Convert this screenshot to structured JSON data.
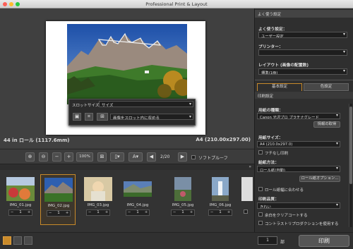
{
  "window": {
    "title": "Professional Print & Layout"
  },
  "slot": {
    "size_label": "スロットサイズ：",
    "size_value": "サイズ",
    "fit_value": "画像をスロット内に収める"
  },
  "info": {
    "roll": "44 in ロール (1117.6mm)",
    "paper": "A4 (210.00x297.00)"
  },
  "toolbar": {
    "zoom": "100%",
    "page": "2/20",
    "softproof": "ソフトプルーフ"
  },
  "thumbs": [
    {
      "name": "IMG_01.jpg",
      "count": "1"
    },
    {
      "name": "IMG_02.jpg",
      "count": "1"
    },
    {
      "name": "IMG_03.jpg",
      "count": "1"
    },
    {
      "name": "IMG_04.jpg",
      "count": "1"
    },
    {
      "name": "IMG_05.jpg",
      "count": "1"
    },
    {
      "name": "IMG_06.jpg",
      "count": "1"
    }
  ],
  "bottom": {
    "copies": "1",
    "unit": "部",
    "print": "印刷"
  },
  "right": {
    "favorites_header": "よく使う設定",
    "favorites_label": "よく使う設定：",
    "favorites_value": "ユーザー設定",
    "printer_label": "プリンター：",
    "layout_label": "レイアウト (画像の配置数)",
    "layout_value": "標準(1面)",
    "tab_basic": "基本設定",
    "tab_color": "色設定",
    "print_settings": "印刷設定",
    "media_label": "用紙の種類：",
    "media_value": "Canon 光沢プロ プラチナグレード",
    "get_info": "情報の取得",
    "paper_size_label": "用紙サイズ：",
    "paper_size_value": "A4 (210.0x297.0)",
    "borderless": "フチなし印刷",
    "feed_label": "給紙方法：",
    "feed_value": "ロール紙(自動)",
    "roll_options": "ロール紙オプション...",
    "fit_roll": "ロール紙幅に合わせる",
    "quality_label": "印刷品質：",
    "quality_value": "きれい",
    "clear_margin": "余白をクリアコートする",
    "contrast": "コントラストリプロダクションを使用する"
  },
  "colors": {
    "accent": "#c98a2a",
    "panel": "#2f2f2f"
  }
}
